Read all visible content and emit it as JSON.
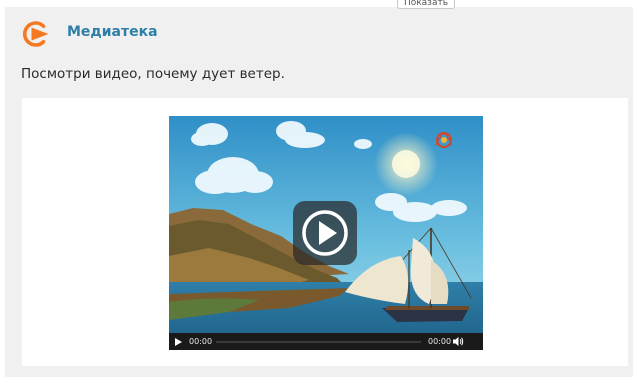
{
  "header": {
    "show_tab_label": "Показать",
    "title": "Медиатека",
    "icon": "media-play-icon",
    "accent_color": "#f47920",
    "title_color": "#2e7fa8"
  },
  "content": {
    "prompt": "Посмотри видео, почему дует ветер."
  },
  "video": {
    "current_time": "00:00",
    "duration": "00:00",
    "progress": 0,
    "icons": [
      "play-button-icon",
      "control-play-icon",
      "volume-icon"
    ]
  }
}
